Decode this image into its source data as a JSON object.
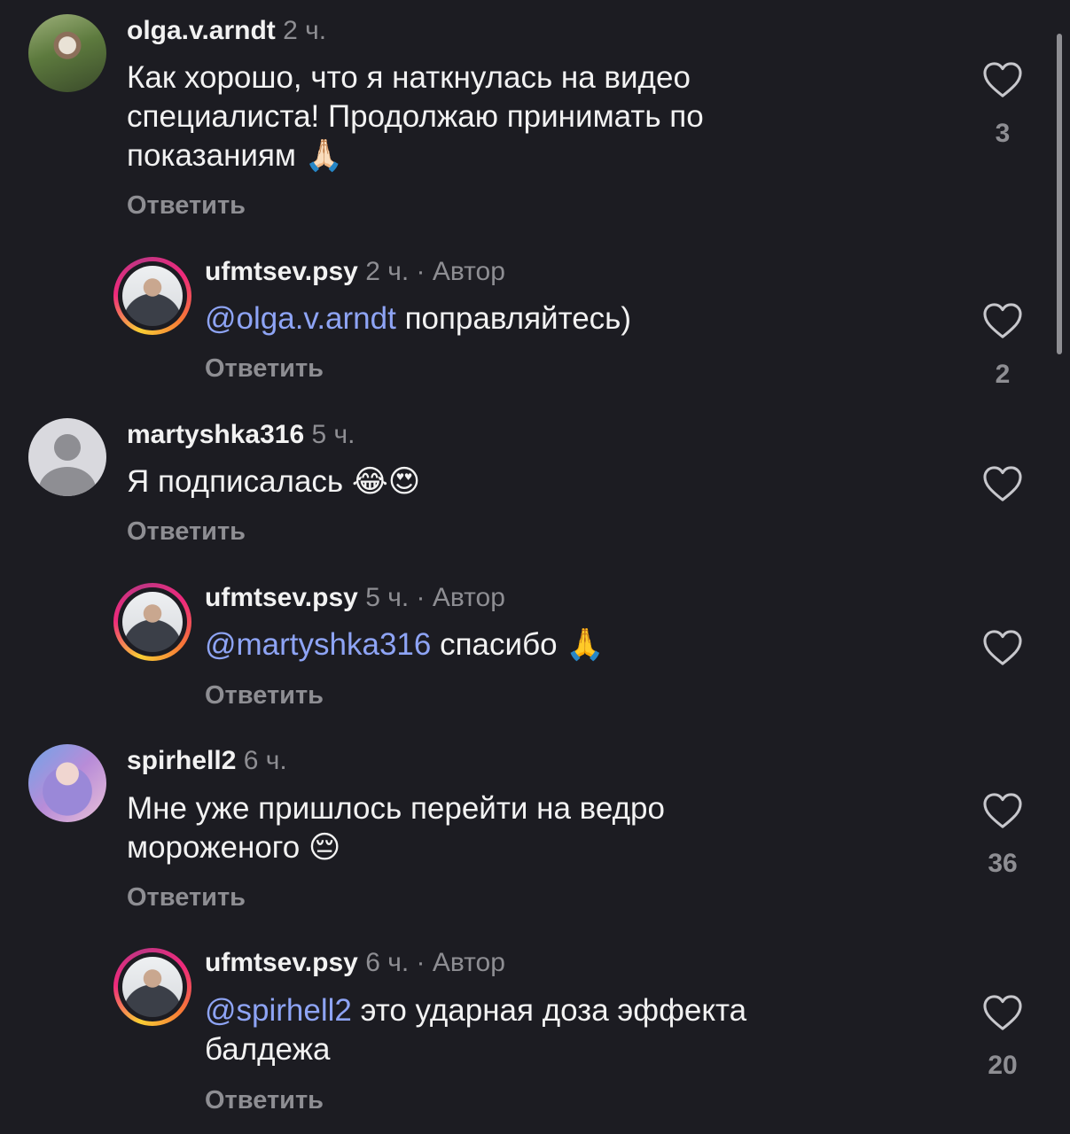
{
  "comments": [
    {
      "username": "olga.v.arndt",
      "time": "2 ч.",
      "text": "Как хорошо, что я наткнулась на видео специалиста! Продолжаю принимать по показаниям 🙏🏻",
      "reply_label": "Ответить",
      "likes": "3",
      "avatar_icon": "user-photo"
    },
    {
      "username": "ufmtsev.psy",
      "time": "2 ч. ·",
      "author_label": "Автор",
      "mention": "@olga.v.arndt",
      "text": "поправляйтесь)",
      "reply_label": "Ответить",
      "likes": "2",
      "avatar_icon": "story-ring-avatar"
    },
    {
      "username": "martyshka316",
      "time": "5 ч.",
      "text": "Я подписалась 😂😍",
      "reply_label": "Ответить",
      "avatar_icon": "default-avatar"
    },
    {
      "username": "ufmtsev.psy",
      "time": "5 ч. ·",
      "author_label": "Автор",
      "mention": "@martyshka316",
      "text": "спасибо 🙏",
      "reply_label": "Ответить",
      "avatar_icon": "story-ring-avatar"
    },
    {
      "username": "spirhell2",
      "time": "6 ч.",
      "text": "Мне уже пришлось перейти на ведро мороженого 😔",
      "reply_label": "Ответить",
      "likes": "36",
      "avatar_icon": "user-photo"
    },
    {
      "username": "ufmtsev.psy",
      "time": "6 ч. ·",
      "author_label": "Автор",
      "mention": "@spirhell2",
      "text": "это ударная доза эффекта балдежа",
      "reply_label": "Ответить",
      "likes": "20",
      "avatar_icon": "story-ring-avatar"
    }
  ],
  "colors": {
    "background": "#1c1c22",
    "text": "#f2f2f2",
    "muted": "#8e8e93",
    "mention": "#8ea4f5"
  },
  "icons": {
    "like": "heart-outline-icon"
  }
}
